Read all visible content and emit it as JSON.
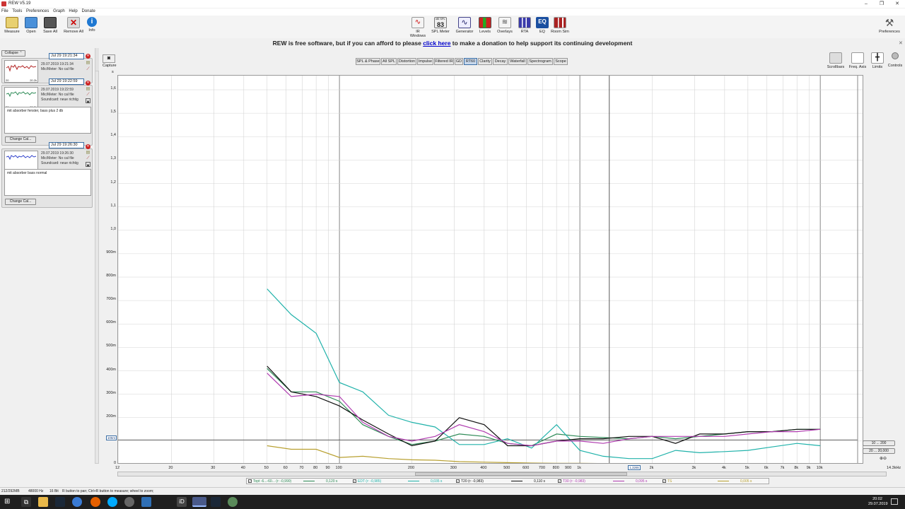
{
  "window": {
    "title": "REW V5.19",
    "controls": [
      "–",
      "❐",
      "✕"
    ]
  },
  "menu": [
    "File",
    "Tools",
    "Preferences",
    "Graph",
    "Help",
    "Donate"
  ],
  "toolbar": {
    "left": [
      {
        "label": "Measure",
        "icon": "measure-icon"
      },
      {
        "label": "Open",
        "icon": "folder-icon"
      },
      {
        "label": "Save All",
        "icon": "save-icon"
      },
      {
        "label": "Remove All",
        "icon": "remove-icon"
      },
      {
        "label": "Info",
        "icon": "info-icon"
      }
    ],
    "center": [
      {
        "label": "IR Windows",
        "icon": "ir-windows-icon"
      },
      {
        "label": "SPL Meter",
        "icon": "spl-meter-icon",
        "value": "83",
        "unit": "dB SPL"
      },
      {
        "label": "Generator",
        "icon": "generator-icon"
      },
      {
        "label": "Levels",
        "icon": "levels-icon"
      },
      {
        "label": "Overlays",
        "icon": "overlays-icon"
      },
      {
        "label": "RTA",
        "icon": "rta-icon"
      },
      {
        "label": "EQ",
        "icon": "eq-icon"
      },
      {
        "label": "Room Sim",
        "icon": "room-sim-icon"
      }
    ],
    "preferences": "Preferences"
  },
  "banner": {
    "before": "REW is free software, but if you can afford to please ",
    "link": "click here",
    "after": " to make a donation to help support its continuing development"
  },
  "leftpanel": {
    "collapse_label": "Collapse",
    "measurements": [
      {
        "name": "Jul 29 19:21:34",
        "date": "29.07.2019 19:21:34",
        "mic": "Mic/Meter: No cal file",
        "soundcard": "",
        "notes": "",
        "thumb_start": "20",
        "thumb_end": "20.2k",
        "trace_color": "#b22222"
      },
      {
        "name": "Jul 29 19:22:59",
        "date": "29.07.2019 19:22:59",
        "mic": "Mic/Meter: No cal file",
        "soundcard": "Soundcard: neue richtig",
        "notes": "mit absorber fenster, bass plus 2 db",
        "thumb_start": "20",
        "thumb_end": "20.2k",
        "trace_color": "#2e8b57",
        "change_cal": "Change Cal..."
      },
      {
        "name": "Jul 29 19:26:30",
        "date": "29.07.2019 19:26:30",
        "mic": "Mic/Meter: No cal file",
        "soundcard": "Soundcard: neue richtig",
        "notes": "mit absorber bass normal",
        "thumb_start": "20",
        "thumb_end": "20.2k",
        "trace_color": "#3344cc",
        "change_cal": "Change Cal..."
      }
    ]
  },
  "graph": {
    "capture_label": "Capture",
    "tabs": [
      "SPL & Phase",
      "All SPL",
      "Distortion",
      "Impulse",
      "Filtered IR",
      "GD",
      "RT60",
      "Clarity",
      "Decay",
      "Waterfall",
      "Spectrogram",
      "Scope"
    ],
    "active_tab": "RT60",
    "right_controls": [
      "Scrollbars",
      "Freq. Axis",
      "Limits",
      "Controls"
    ],
    "y_ticks": [
      "1,6",
      "1,5",
      "1,4",
      "1,3",
      "1,2",
      "1,1",
      "1,0",
      "900m",
      "800m",
      "700m",
      "600m",
      "500m",
      "400m",
      "300m",
      "200m",
      "100m",
      "0"
    ],
    "y_top_label": "s",
    "x_ticks": [
      "12",
      "20",
      "30",
      "40",
      "50",
      "60",
      "70",
      "80",
      "90",
      "100",
      "200",
      "300",
      "400",
      "500",
      "600",
      "700",
      "800",
      "900",
      "1k",
      "2k",
      "3k",
      "4k",
      "5k",
      "6k",
      "7k",
      "8k",
      "9k",
      "10k"
    ],
    "x_end_label": "14.3kHz",
    "cursor_x_label": "1,326k",
    "cursor_y_label": "105m",
    "range_buttons": [
      "10 ... 200",
      "20 ... 20,000"
    ]
  },
  "chart_data": {
    "type": "line",
    "xlabel": "",
    "ylabel": "s",
    "x_scale": "log",
    "xlim": [
      12,
      14300
    ],
    "ylim": [
      0,
      1.6
    ],
    "x": [
      50,
      63,
      80,
      100,
      125,
      160,
      200,
      250,
      315,
      400,
      500,
      630,
      800,
      1000,
      1250,
      1600,
      2000,
      2500,
      3150,
      4000,
      5000,
      6300,
      8000,
      10000
    ],
    "series": [
      {
        "name": "Topt -6...-60...",
        "color": "#2e8b57",
        "values": [
          0.41,
          0.31,
          0.31,
          0.27,
          0.17,
          0.12,
          0.085,
          0.1,
          0.13,
          0.12,
          0.09,
          0.08,
          0.13,
          0.12,
          0.115,
          0.11,
          0.12,
          0.11,
          0.12,
          0.13,
          0.14,
          0.14,
          0.15,
          0.15
        ]
      },
      {
        "name": "EDT (r: -0,985)",
        "color": "#20b2aa",
        "values": [
          0.75,
          0.64,
          0.56,
          0.35,
          0.31,
          0.21,
          0.18,
          0.16,
          0.085,
          0.085,
          0.11,
          0.07,
          0.17,
          0.06,
          0.035,
          0.025,
          0.025,
          0.06,
          0.05,
          0.055,
          0.06,
          0.075,
          0.09,
          0.08
        ]
      },
      {
        "name": "T20 (r: -0,983)",
        "color": "#111111",
        "values": [
          0.42,
          0.31,
          0.29,
          0.25,
          0.19,
          0.13,
          0.08,
          0.1,
          0.2,
          0.17,
          0.08,
          0.08,
          0.1,
          0.11,
          0.11,
          0.12,
          0.12,
          0.09,
          0.13,
          0.13,
          0.14,
          0.14,
          0.15,
          0.15
        ]
      },
      {
        "name": "T30 (r: -0,983)",
        "color": "#b03cb0",
        "values": [
          0.39,
          0.29,
          0.3,
          0.29,
          0.18,
          0.12,
          0.1,
          0.12,
          0.17,
          0.14,
          0.09,
          0.08,
          0.1,
          0.1,
          0.09,
          0.11,
          0.12,
          0.12,
          0.12,
          0.12,
          0.13,
          0.14,
          0.14,
          0.15
        ]
      },
      {
        "name": "TS",
        "color": "#b8a030",
        "values": [
          0.08,
          0.065,
          0.065,
          0.03,
          0.035,
          0.025,
          0.02,
          0.018,
          0.012,
          0.01,
          0.008,
          0.006,
          0.005,
          0.005,
          0.004,
          0.004,
          0.004,
          0.003,
          0.003,
          0.003,
          0.003,
          0.003,
          0.003,
          0.003
        ]
      }
    ],
    "reference_line_y": 0.105,
    "cursor_x": 1326
  },
  "legend": [
    {
      "label": "Topt -6...-60... (r: -0,990)",
      "value": "0,120 s",
      "color": "#2e8b57"
    },
    {
      "label": "EDT (r: -0,985)",
      "value": "0,035 s",
      "color": "#20b2aa"
    },
    {
      "label": "T20 (r: -0,983)",
      "value": "0,110 s",
      "color": "#111111"
    },
    {
      "label": "T30 (r: -0,983)",
      "value": "0,095 s",
      "color": "#b03cb0"
    },
    {
      "label": "TS",
      "value": "0,005 s",
      "color": "#b8a030"
    }
  ],
  "status": {
    "memory": "212/292MB",
    "rate": "48000 Hz",
    "bits": "16 Bit",
    "hint": "R button to pan; Ctrl+R button to measure; wheel to zoom;"
  },
  "taskbar": {
    "time": "20:02",
    "date": "29.07.2019"
  }
}
